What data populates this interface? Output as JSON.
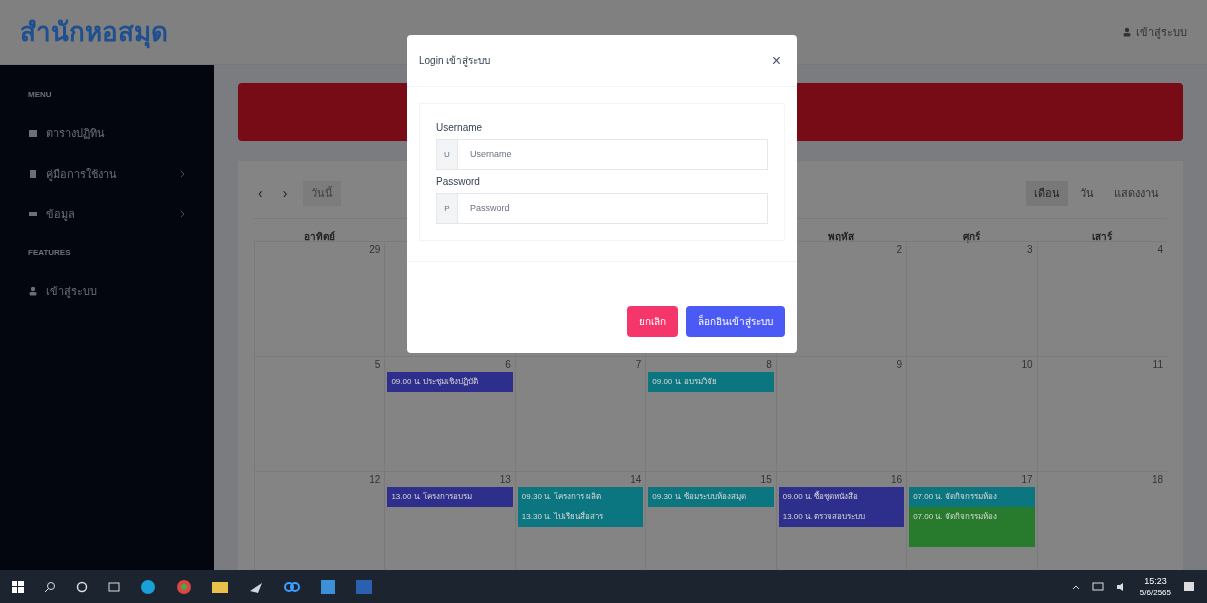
{
  "header": {
    "brand": "สำนักหอสมุด",
    "user_link": "เข้าสู่ระบบ"
  },
  "sidebar": {
    "sections": [
      {
        "heading": "MENU",
        "items": [
          {
            "label": "ตารางปฏิทิน",
            "expandable": false
          },
          {
            "label": "คู่มือการใช้งาน",
            "expandable": true
          },
          {
            "label": "ข้อมูล",
            "expandable": true
          }
        ]
      },
      {
        "heading": "FEATURES",
        "items": [
          {
            "label": "เข้าสู่ระบบ",
            "expandable": false
          }
        ]
      }
    ]
  },
  "calendar": {
    "prev": "‹",
    "next": "›",
    "today_button": "วันนี้",
    "views": [
      {
        "label": "เดือน",
        "selected": true
      },
      {
        "label": "วัน",
        "selected": false
      },
      {
        "label": "แสดงงาน",
        "selected": false
      }
    ],
    "weekdays": [
      {
        "label": "อาทิตย์"
      },
      {
        "label": "พฤหัส"
      },
      {
        "label": "ศุกร์"
      },
      {
        "label": "เสาร์"
      }
    ],
    "weeks": [
      [
        {
          "date": "29"
        },
        {
          "date": "2"
        },
        {
          "date": "3"
        },
        {
          "date": "4"
        }
      ],
      [
        {
          "date": "5"
        },
        {
          "date": "6",
          "events": [
            {
              "text": "09.00 น. ประชุมเชิงปฏิบัติ",
              "color": "#2e2e8c"
            }
          ]
        },
        {
          "date": "7"
        },
        {
          "date": "8",
          "events": [
            {
              "text": "09.00 น. อบรมวิจัย",
              "color": "#0b7680"
            }
          ]
        },
        {
          "date": "9"
        },
        {
          "date": "10"
        },
        {
          "date": "11"
        }
      ],
      [
        {
          "date": "12"
        },
        {
          "date": "13",
          "events": [
            {
              "text": "13.00 น. โครงการอบรม",
              "color": "#2e2e8c"
            }
          ]
        },
        {
          "date": "14",
          "events": [
            {
              "text": "09.30 น. โครงการ ผลิต",
              "color": "#0b7680"
            },
            {
              "text": "13.30 น. ไปเรียนสื่อสาร",
              "color": "#0b7680"
            }
          ]
        },
        {
          "date": "15",
          "events": [
            {
              "text": "09.30 น. ซ้อมระบบห้องสมุด",
              "color": "#0b7680"
            }
          ]
        },
        {
          "date": "16",
          "events": [
            {
              "text": "09.00 น. ซื้อชุดหนังสือ",
              "color": "#2e2e8c"
            },
            {
              "text": "13.00 น. ตรวจสอบระบบ",
              "color": "#2e2e8c"
            }
          ]
        },
        {
          "date": "17",
          "events": [
            {
              "text": "07.00 น. จัดกิจกรรมห้อง",
              "color": "#0b7680"
            },
            {
              "text": "07.00 น. จัดกิจกรรมห้อง",
              "color": "#287a2c"
            },
            {
              "color": "#287a2c"
            }
          ]
        },
        {
          "date": "18"
        }
      ]
    ]
  },
  "modal": {
    "title": "Login เข้าสู่ระบบ",
    "close": "×",
    "fields": [
      {
        "label": "Username",
        "prefix": "U",
        "placeholder": "Username"
      },
      {
        "label": "Password",
        "prefix": "P",
        "placeholder": "Password"
      }
    ],
    "buttons": [
      {
        "label": "ยกเลิก",
        "kind": "cancel"
      },
      {
        "label": "ล็อกอินเข้าสู่ระบบ",
        "kind": "submit"
      }
    ]
  },
  "taskbar": {
    "time": "15:23",
    "date": "5/6/2565"
  }
}
